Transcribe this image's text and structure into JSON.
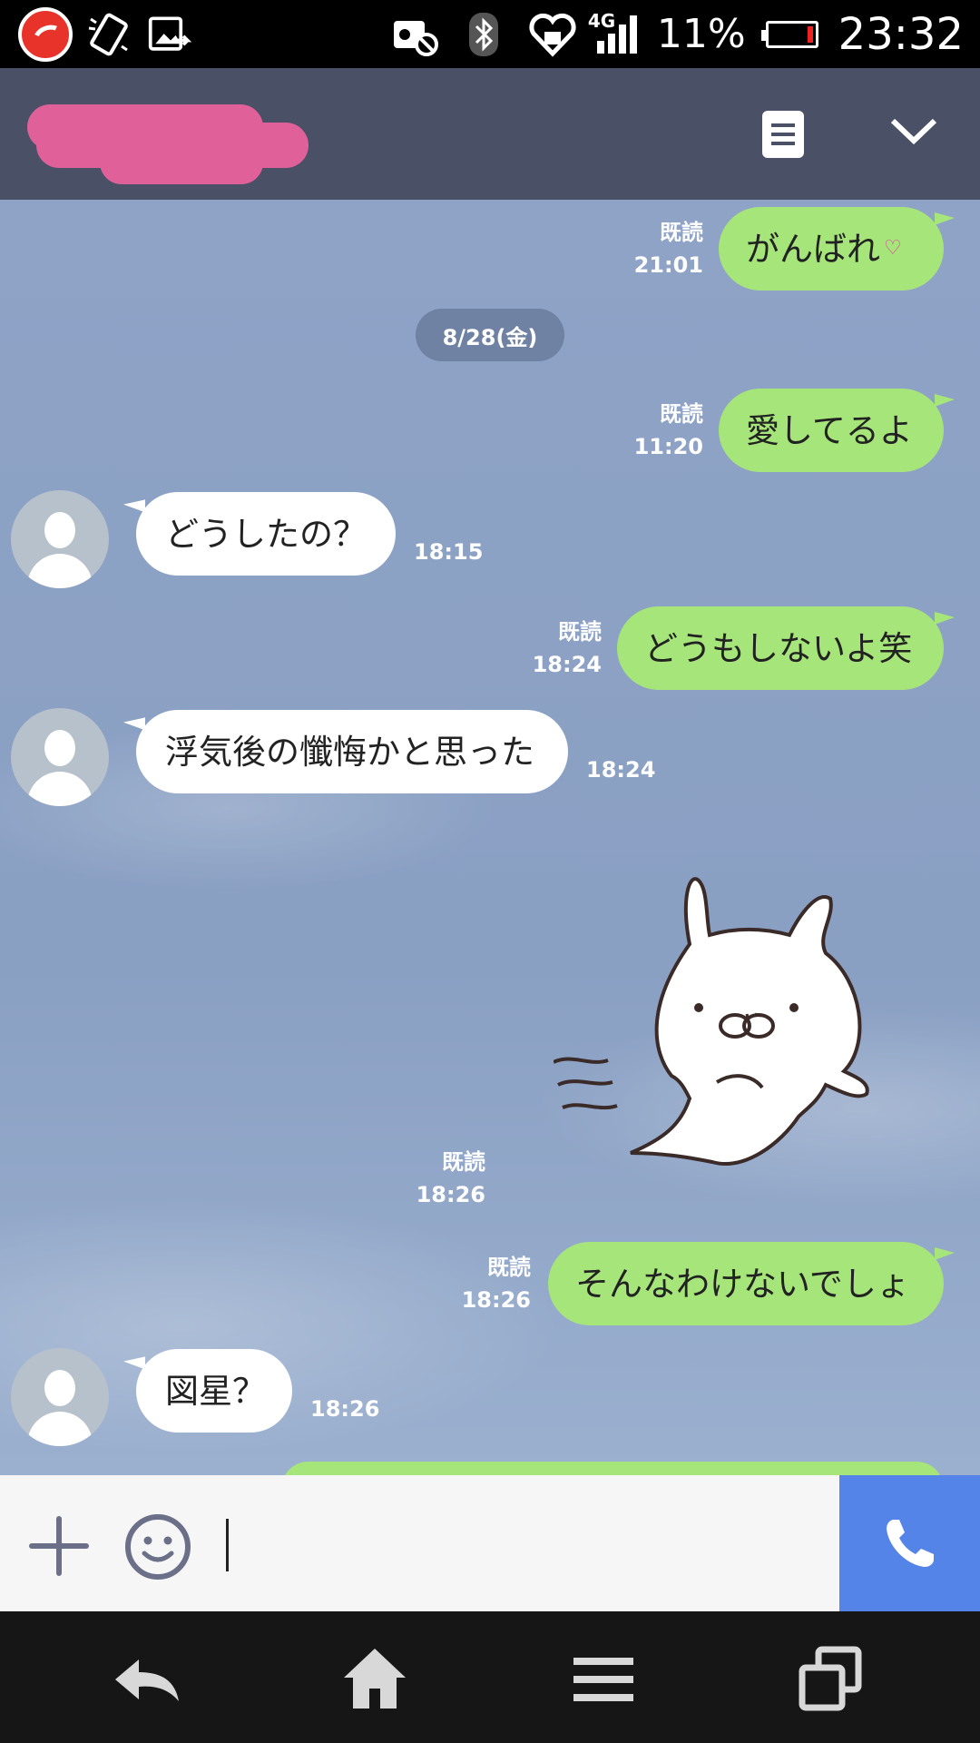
{
  "status_bar": {
    "battery_percent": "11%",
    "network": "4G",
    "time": "23:32",
    "icons": [
      "trendmicro-icon",
      "screen-rotate-icon",
      "screenshot-share-icon",
      "vibrate-off-icon",
      "bluetooth-icon",
      "heart-health-icon",
      "signal-icon",
      "battery-icon"
    ]
  },
  "header": {
    "contact_name_redacted": true,
    "icons": [
      "notes-icon",
      "chevron-down-icon"
    ]
  },
  "chat": {
    "date_divider": "8/28(金)",
    "messages": [
      {
        "side": "out",
        "text": "がんばれ",
        "read": "既読",
        "time": "21:01"
      },
      {
        "side": "out",
        "text": "愛してるよ",
        "read": "既読",
        "time": "11:20"
      },
      {
        "side": "in",
        "text": "どうしたの？",
        "time": "18:15"
      },
      {
        "side": "out",
        "text": "どうもしないよ笑",
        "read": "既読",
        "time": "18:24"
      },
      {
        "side": "in",
        "text": "浮気後の懺悔かと思った",
        "time": "18:24"
      },
      {
        "side": "out",
        "type": "sticker",
        "sticker": "ghost-rabbit-sticker",
        "read": "既読",
        "time": "18:26"
      },
      {
        "side": "out",
        "text": "そんなわけないでしょ",
        "read": "既読",
        "time": "18:26"
      },
      {
        "side": "in",
        "text": "図星？",
        "time": "18:26"
      }
    ]
  },
  "input_bar": {
    "text_value": "",
    "icons": [
      "plus-icon",
      "emoji-icon",
      "phone-icon"
    ]
  },
  "nav_bar": {
    "icons": [
      "back-icon",
      "home-icon",
      "menu-icon",
      "recent-apps-icon"
    ]
  },
  "colors": {
    "header_bg": "#4a5066",
    "outgoing_bubble": "#a6e57a",
    "incoming_bubble": "#ffffff",
    "call_button": "#5584e8",
    "redaction": "#e0609a"
  }
}
